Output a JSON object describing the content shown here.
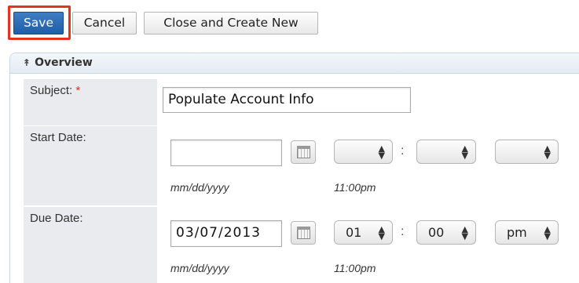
{
  "toolbar": {
    "save_label": "Save",
    "cancel_label": "Cancel",
    "close_create_label": "Close and Create New"
  },
  "panel": {
    "title": "Overview",
    "chevron_icon": "double-chevron-up-icon"
  },
  "fields": {
    "subject": {
      "label": "Subject:",
      "required_marker": "*",
      "value": "Populate Account Info"
    },
    "start_date": {
      "label": "Start Date:",
      "date_value": "",
      "hour": "",
      "minute": "",
      "ampm": "",
      "date_format_hint": "mm/dd/yyyy",
      "time_hint": "11:00pm"
    },
    "due_date": {
      "label": "Due Date:",
      "date_value": "03/07/2013",
      "hour": "01",
      "minute": "00",
      "ampm": "pm",
      "date_format_hint": "mm/dd/yyyy",
      "time_hint": "11:00pm"
    }
  },
  "colors": {
    "save_button": "#2a69b3",
    "highlight_border": "#e53321",
    "required_marker": "#e53321",
    "label_background": "#e9ebee"
  }
}
